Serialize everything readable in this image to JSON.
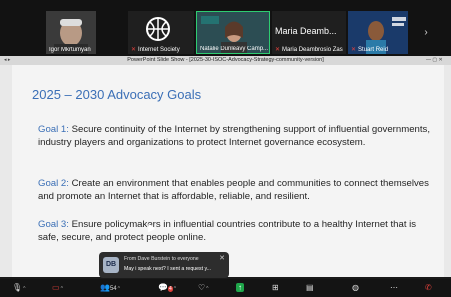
{
  "participants": [
    {
      "name": "Igor Mkrtumyan",
      "mic_muted": false
    },
    {
      "name": "Internet Society",
      "mic_muted": true
    },
    {
      "name": "Natalie Dunleavy Camp...",
      "mic_muted": false,
      "active": true
    },
    {
      "name": "Maria Deambrosio Zas",
      "display_text": "Maria Deamb...",
      "mic_muted": true
    },
    {
      "name": "Stuart Reid",
      "mic_muted": true
    }
  ],
  "window_title": "PowerPoint Slide Show - [2025-30-ISOC-Advocacy-Strategy-community-version]",
  "slide": {
    "title": "2025 – 2030 Advocacy Goals",
    "goals": [
      {
        "label": "Goal 1:",
        "text": " Secure continuity of the Internet by strengthening support of influential governments, industry players and organizations to protect Internet governance ecosystem."
      },
      {
        "label": "Goal 2:",
        "text": " Create an environment that enables people and communities to connect themselves and promote an Internet that is affordable, reliable, and resilient."
      },
      {
        "label": "Goal 3:",
        "text": " Ensure policymakers in influential countries contribute to a healthy Internet that is safe, secure, and protect people online."
      }
    ]
  },
  "chat_toast": {
    "avatar": "DB",
    "from": "From Dave Burstein to everyone",
    "message": "May i speak next? I sent a request y..."
  },
  "toolbar": {
    "participants_count": "54",
    "chat_badge": "4",
    "colors": {
      "share": "#1fa64a",
      "muted": "#e0403b",
      "accent": "#3b6fb6"
    }
  }
}
